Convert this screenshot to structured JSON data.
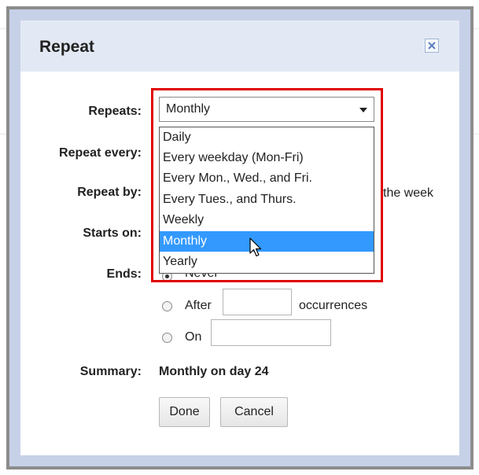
{
  "dialog": {
    "title": "Repeat",
    "close_icon": "close-icon"
  },
  "form": {
    "repeats_label": "Repeats:",
    "repeats_value": "Monthly",
    "repeat_every_label": "Repeat every:",
    "repeat_by_label": "Repeat by:",
    "repeat_by_partial_text": "the week",
    "starts_on_label": "Starts on:",
    "ends_label": "Ends:",
    "ends_never_partial": "Never",
    "ends_after_label": "After",
    "ends_after_value": "",
    "occurrences_label": "occurrences",
    "ends_on_label": "On",
    "ends_on_value": "",
    "summary_label": "Summary:",
    "summary_value": "Monthly on day 24"
  },
  "dropdown": {
    "options": [
      "Daily",
      "Every weekday (Mon-Fri)",
      "Every Mon., Wed., and Fri.",
      "Every Tues., and Thurs.",
      "Weekly",
      "Monthly",
      "Yearly"
    ],
    "selected": "Monthly"
  },
  "buttons": {
    "done": "Done",
    "cancel": "Cancel"
  },
  "colors": {
    "highlight": "#e00000",
    "selected_option": "#3399ff",
    "header_bg": "#e3e9f4"
  }
}
